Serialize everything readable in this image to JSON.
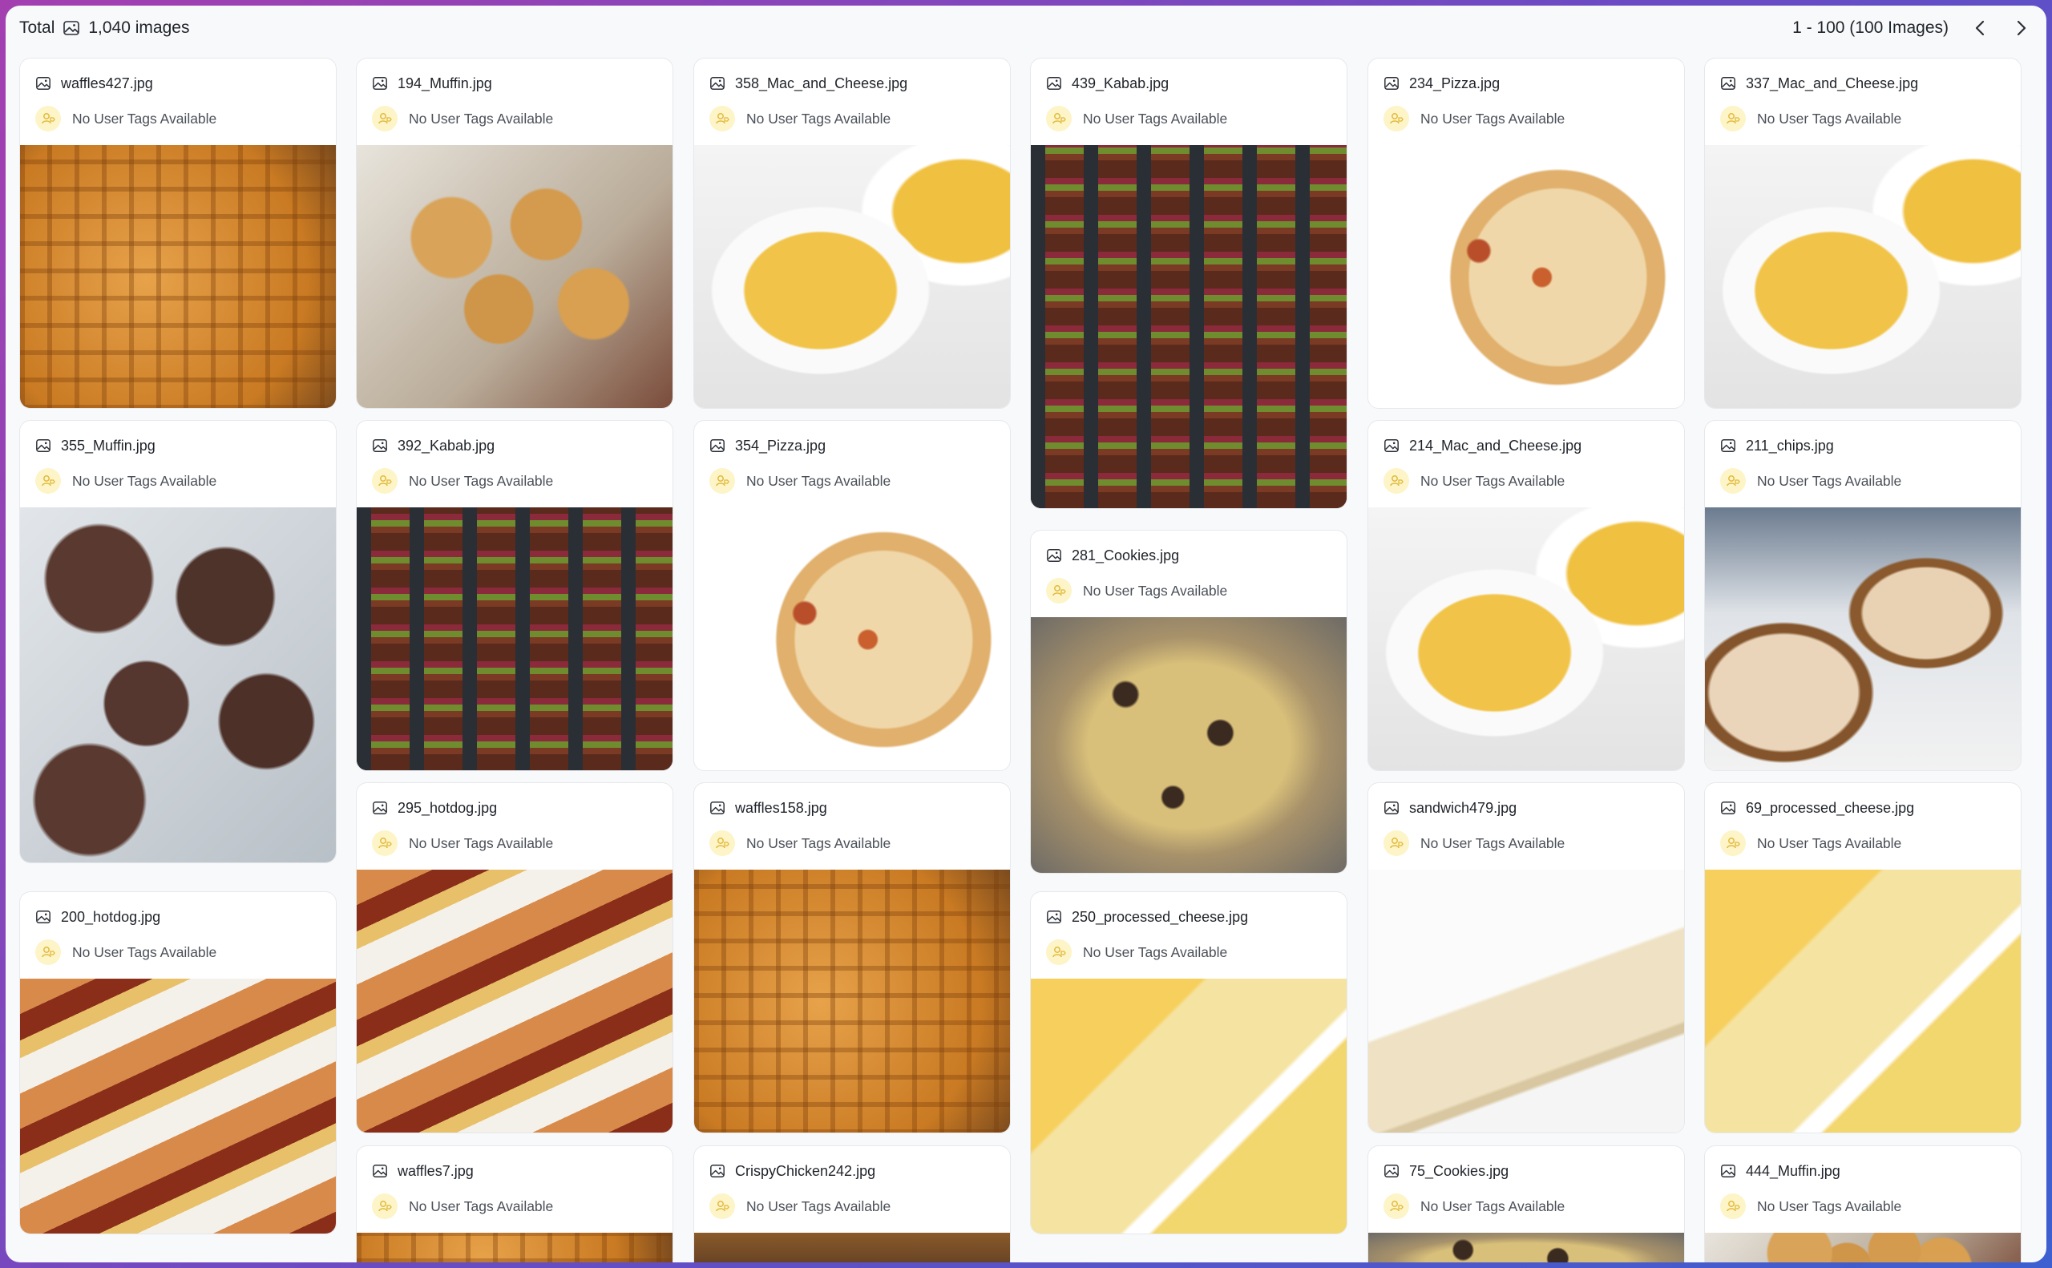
{
  "header": {
    "total_label": "Total",
    "total_count": "1,040 images",
    "range_text": "1 - 100 (100 Images)"
  },
  "no_tags_label": "No User Tags Available",
  "colors": {
    "accent_avatar_bg": "#fdf4c7",
    "accent_avatar_fg": "#e2b93b",
    "border": "#e6e8ec"
  },
  "cards": [
    {
      "filename": "waffles427.jpg",
      "tags": "No User Tags Available",
      "image": "waffles"
    },
    {
      "filename": "194_Muffin.jpg",
      "tags": "No User Tags Available",
      "image": "muffins"
    },
    {
      "filename": "358_Mac_and_Cheese.jpg",
      "tags": "No User Tags Available",
      "image": "mac-and-cheese"
    },
    {
      "filename": "439_Kabab.jpg",
      "tags": "No User Tags Available",
      "image": "kabab"
    },
    {
      "filename": "234_Pizza.jpg",
      "tags": "No User Tags Available",
      "image": "pizza"
    },
    {
      "filename": "337_Mac_and_Cheese.jpg",
      "tags": "No User Tags Available",
      "image": "mac-and-cheese"
    },
    {
      "filename": "355_Muffin.jpg",
      "tags": "No User Tags Available",
      "image": "chocolate-muffins"
    },
    {
      "filename": "392_Kabab.jpg",
      "tags": "No User Tags Available",
      "image": "kabab"
    },
    {
      "filename": "354_Pizza.jpg",
      "tags": "No User Tags Available",
      "image": "pizza"
    },
    {
      "filename": "281_Cookies.jpg",
      "tags": "No User Tags Available",
      "image": "cookies"
    },
    {
      "filename": "214_Mac_and_Cheese.jpg",
      "tags": "No User Tags Available",
      "image": "mac-and-cheese"
    },
    {
      "filename": "211_chips.jpg",
      "tags": "No User Tags Available",
      "image": "chips"
    },
    {
      "filename": "295_hotdog.jpg",
      "tags": "No User Tags Available",
      "image": "hotdog"
    },
    {
      "filename": "waffles158.jpg",
      "tags": "No User Tags Available",
      "image": "waffles"
    },
    {
      "filename": "sandwich479.jpg",
      "tags": "No User Tags Available",
      "image": "sandwich"
    },
    {
      "filename": "69_processed_cheese.jpg",
      "tags": "No User Tags Available",
      "image": "cheese"
    },
    {
      "filename": "200_hotdog.jpg",
      "tags": "No User Tags Available",
      "image": "hotdog"
    },
    {
      "filename": "250_processed_cheese.jpg",
      "tags": "No User Tags Available",
      "image": "cheese"
    },
    {
      "filename": "waffles7.jpg",
      "tags": "No User Tags Available",
      "image": "waffles"
    },
    {
      "filename": "CrispyChicken242.jpg",
      "tags": "No User Tags Available",
      "image": "crispy-chicken"
    },
    {
      "filename": "75_Cookies.jpg",
      "tags": "No User Tags Available",
      "image": "cookies"
    },
    {
      "filename": "444_Muffin.jpg",
      "tags": "No User Tags Available",
      "image": "muffins"
    }
  ]
}
